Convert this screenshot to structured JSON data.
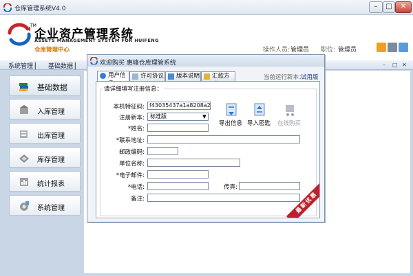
{
  "window": {
    "title": "仓库管理系统V4.0",
    "controls": [
      "–",
      "□",
      "✕"
    ]
  },
  "header": {
    "logo_cn": "企业资产管理系统",
    "logo_tm": "TM",
    "logo_en": "ASSETS MANAGEMENT SYSTEM FOR HUIFENG",
    "logo_sub": "仓库管理中心",
    "operator_label": "操作人员:",
    "operator_value": "管理员",
    "position_label": "职位:",
    "position_value": "管理员"
  },
  "menubar": {
    "items": [
      "系统管理 ▏",
      "基础数据 ▏"
    ],
    "controls": [
      "–",
      "□",
      "✕"
    ]
  },
  "sidebar": {
    "items": [
      {
        "label": "基础数据",
        "icon": "books-icon"
      },
      {
        "label": "入库管理",
        "icon": "stock-in-icon"
      },
      {
        "label": "出库管理",
        "icon": "stock-out-icon"
      },
      {
        "label": "库存管理",
        "icon": "inventory-icon"
      },
      {
        "label": "统计报表",
        "icon": "report-icon"
      },
      {
        "label": "系统管理",
        "icon": "settings-icon"
      }
    ]
  },
  "dialog": {
    "title": "欢迎购买 惠峰仓库理管系统",
    "tabs": [
      "用户信息",
      "许可协议",
      "版本说明",
      "汇款方式"
    ],
    "version_label": "当前运行新本：",
    "version_value": "试用版",
    "fieldset_label": "请详细填写注册信息：",
    "fields": {
      "machine_code_label": "本机特征码:",
      "machine_code_value": "f43035437a1a8208a2",
      "reg_version_label": "注册新本:",
      "reg_version_value": "标准版",
      "name_label": "*姓名:",
      "address_label": "*联系地址:",
      "postcode_label": "邮政编码:",
      "company_label": "单位名称:",
      "email_label": "*电子邮件:",
      "phone_label": "*电话:",
      "fax_label": "传真:",
      "remark_label": "备注:"
    },
    "actions": [
      "导出信息",
      "导入密匙",
      "在线购买"
    ],
    "ribbon": "最新优惠"
  }
}
